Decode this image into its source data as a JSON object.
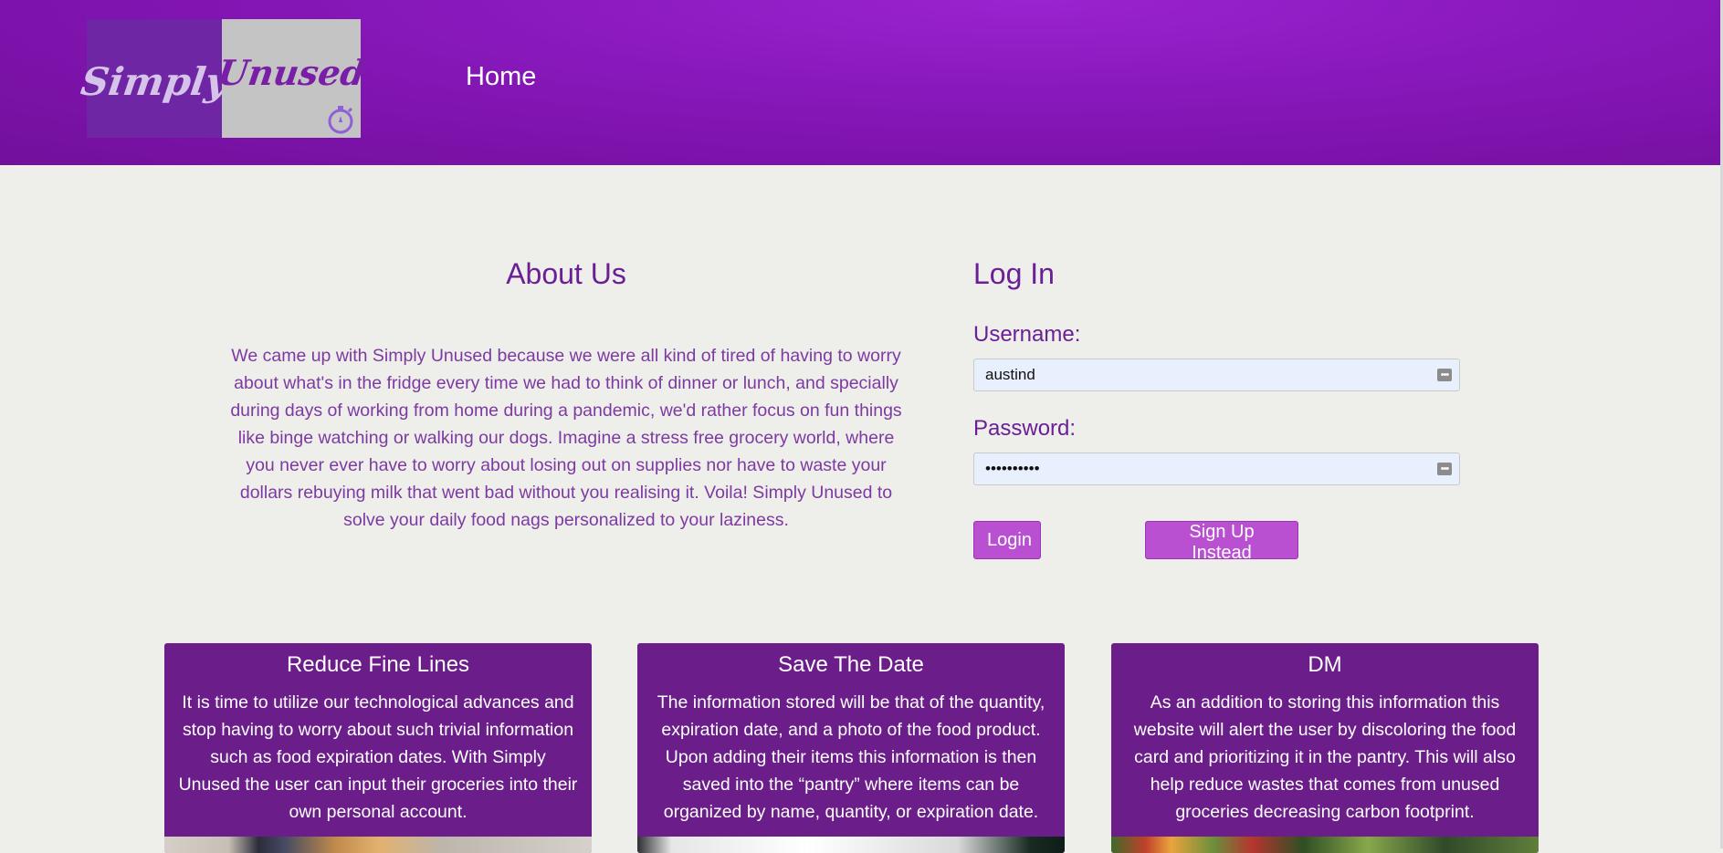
{
  "header": {
    "logo": {
      "word1": "Simply",
      "word2": "Unused"
    },
    "nav": {
      "home": "Home"
    }
  },
  "about": {
    "title": "About Us",
    "text": "We came up with Simply Unused because we were all kind of tired of having to worry about what's in the fridge every time we had to think of dinner or lunch, and specially during days of working from home during a pandemic, we'd rather focus on fun things like binge watching or walking our dogs. Imagine a stress free grocery world, where you never ever have to worry about losing out on supplies nor have to waste your dollars rebuying milk that went bad without you realising it. Voila! Simply Unused to solve your daily food nags personalized to your laziness."
  },
  "login": {
    "title": "Log In",
    "username_label": "Username:",
    "username_value": "austind",
    "password_label": "Password:",
    "password_value": "••••••••••",
    "login_button": "Login",
    "signup_button": "Sign Up Instead"
  },
  "cards": [
    {
      "title": "Reduce Fine Lines",
      "text": "It is time to utilize our technological advances and stop having to worry about such trivial information such as food expiration dates. With Simply Unused the user can input their groceries into their own personal account."
    },
    {
      "title": "Save The Date",
      "text": "The information stored will be that of the quantity, expiration date, and a photo of the food product. Upon adding their items this information is then saved into the “pantry” where items can be organized by name, quantity, or expiration date."
    },
    {
      "title": "DM",
      "text": "As an addition to storing this information this website will alert the user by discoloring the food card and prioritizing it in the pantry. This will also help reduce wastes that comes from unused groceries decreasing carbon footprint."
    }
  ],
  "colors": {
    "header": "#8a19be",
    "heading": "#6a1f96",
    "button": "#b94fd1",
    "card": "#6b1d8a",
    "field": "#e8f0fe"
  }
}
